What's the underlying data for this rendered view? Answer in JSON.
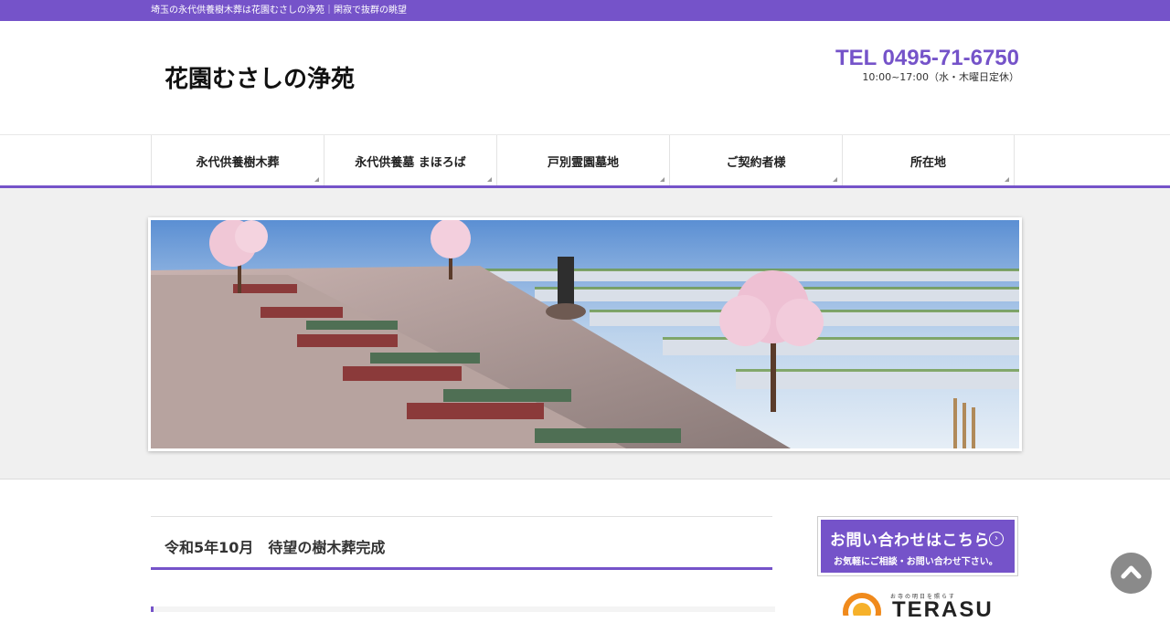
{
  "top_bar": {
    "tagline": "埼玉の永代供養樹木葬は花園むさしの浄苑｜閑寂で抜群の眺望"
  },
  "header": {
    "logo_text": "花園むさしの浄苑",
    "tel": "TEL 0495-71-6750",
    "hours": "10:00~17:00（水・木曜日定休）"
  },
  "nav": {
    "items": [
      {
        "label": "永代供養樹木葬"
      },
      {
        "label": "永代供養墓 まほろば"
      },
      {
        "label": "戸別霊園墓地"
      },
      {
        "label": "ご契約者様"
      },
      {
        "label": "所在地"
      }
    ]
  },
  "post": {
    "title": "令和5年10月　待望の樹木葬完成"
  },
  "sidebar": {
    "contact_main": "お問い合わせはこちら",
    "contact_sub": "お気軽にご相談・お問い合わせ下さい。",
    "terasu_tagline": "お寺の明日を照らす",
    "terasu_word": "TERASU"
  },
  "colors": {
    "accent": "#7553c9",
    "scroll_button": "#8a8a8a"
  },
  "icons": {
    "contact_arrow": "chevron-right-circle-icon",
    "scroll_top": "chevron-up-icon"
  }
}
